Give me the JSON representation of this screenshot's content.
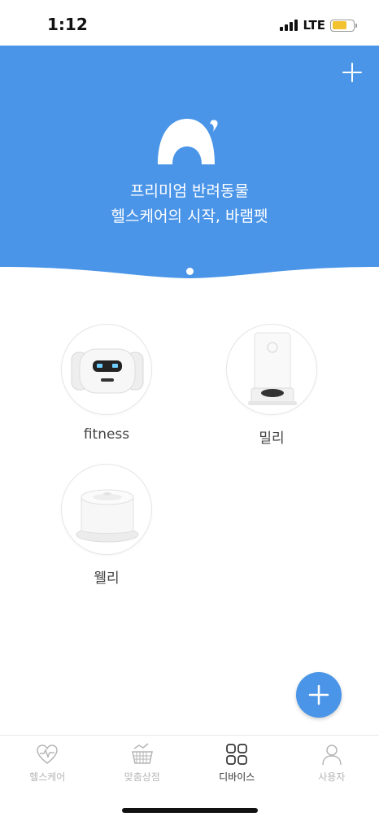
{
  "status_bar": {
    "time": "1:12",
    "network": "LTE",
    "battery_level": 0.7,
    "battery_color": "#f2c230"
  },
  "banner": {
    "line1": "프리미엄 반려동물",
    "line2": "헬스케어의 시작, 바램펫",
    "background_color": "#4a95e8",
    "add_icon": "plus-icon",
    "page_indicator": {
      "current": 1,
      "total": 1
    }
  },
  "devices": [
    {
      "name": "fitness",
      "icon": "fitness-robot-image"
    },
    {
      "name": "밀리",
      "icon": "feeder-image"
    },
    {
      "name": "웰리",
      "icon": "water-fountain-image"
    }
  ],
  "fab": {
    "icon": "plus-icon",
    "color": "#4a95e8"
  },
  "bottom_nav": {
    "items": [
      {
        "label": "헬스케어",
        "icon": "heart-pulse-icon",
        "active": false
      },
      {
        "label": "맞춤상점",
        "icon": "basket-chart-icon",
        "active": false
      },
      {
        "label": "디바이스",
        "icon": "grid-icon",
        "active": true
      },
      {
        "label": "사용자",
        "icon": "user-icon",
        "active": false
      }
    ]
  }
}
